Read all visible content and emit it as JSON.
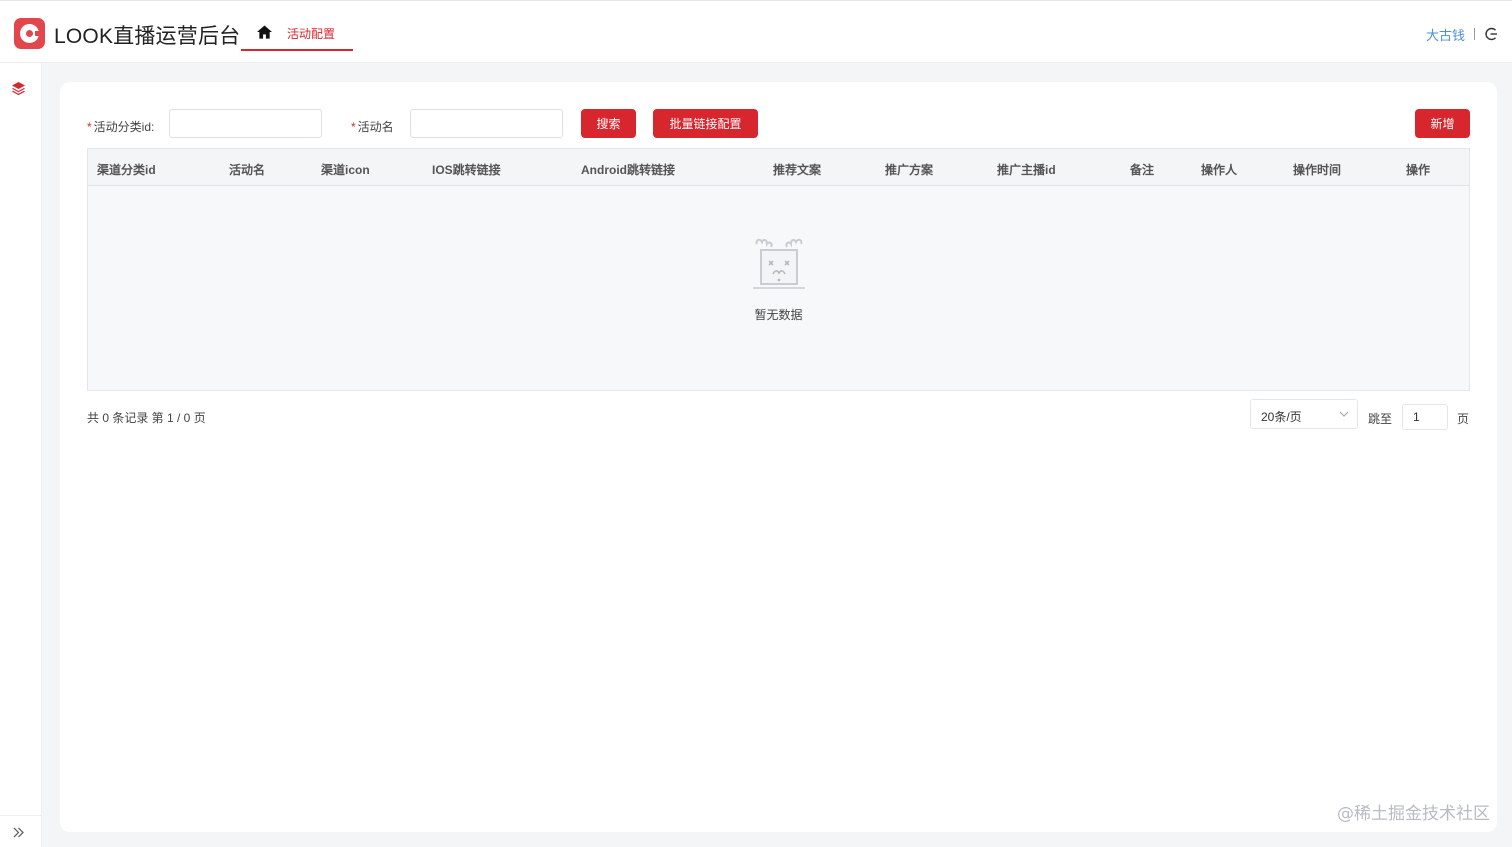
{
  "header": {
    "app_title": "LOOK直播运营后台",
    "active_tab": "活动配置",
    "user_name": "大古钱",
    "separator": "|"
  },
  "filters": {
    "field1_label": "活动分类id:",
    "field1_value": "",
    "field2_label": "活动名",
    "field2_value": "",
    "search_button": "搜索",
    "batch_button": "批量链接配置",
    "add_button": "新增"
  },
  "table": {
    "columns": [
      "渠道分类id",
      "活动名",
      "渠道icon",
      "IOS跳转链接",
      "Android跳转链接",
      "推荐文案",
      "推广方案",
      "推广主播id",
      "备注",
      "操作人",
      "操作时间",
      "操作"
    ],
    "rows": [],
    "empty_text": "暂无数据"
  },
  "pagination": {
    "summary": "共 0 条记录 第 1 / 0 页",
    "page_size": "20条/页",
    "jump_label": "跳至",
    "jump_value": "1",
    "page_suffix": "页"
  },
  "watermark": "@稀土掘金技术社区",
  "colors": {
    "brand": "#d8262e",
    "link": "#4a8fdc",
    "background": "#f3f5f7"
  },
  "icons": {
    "home": "home-icon",
    "logout": "logout-icon",
    "sidebar": "layers-icon",
    "expand": "double-chevron-right-icon"
  }
}
